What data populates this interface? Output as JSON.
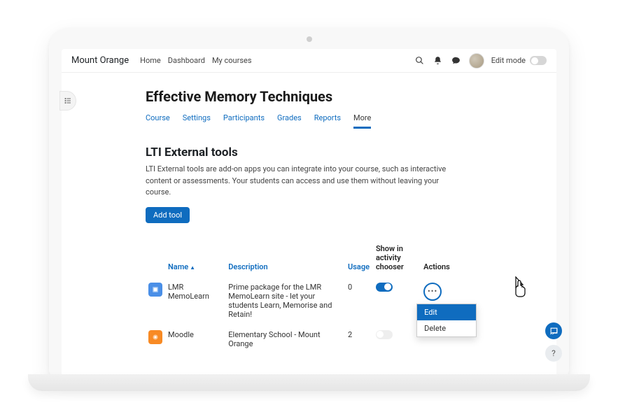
{
  "brand": "Mount Orange",
  "nav": {
    "home": "Home",
    "dashboard": "Dashboard",
    "mycourses": "My courses"
  },
  "editmode_label": "Edit mode",
  "page_title": "Effective Memory Techniques",
  "tabs": {
    "course": "Course",
    "settings": "Settings",
    "participants": "Participants",
    "grades": "Grades",
    "reports": "Reports",
    "more": "More"
  },
  "section": {
    "title": "LTI External tools",
    "desc": "LTI External tools are add-on apps you can integrate into your course, such as interactive content or assessments. Your students can access and use them without leaving your course.",
    "add_button": "Add tool"
  },
  "table": {
    "headers": {
      "name": "Name",
      "description": "Description",
      "usage": "Usage",
      "chooser": "Show in activity chooser",
      "actions": "Actions"
    },
    "rows": [
      {
        "icon_letter": "",
        "icon_class": "blue",
        "name": "LMR MemoLearn",
        "description": "Prime package for the LMR MemoLearn site - let your students Learn, Memorise and Retain!",
        "usage": "0",
        "chooser_on": true
      },
      {
        "icon_letter": "",
        "icon_class": "orange",
        "name": "Moodle",
        "description": "Elementary School - Mount Orange",
        "usage": "2",
        "chooser_on": false
      }
    ]
  },
  "dropdown": {
    "edit": "Edit",
    "delete": "Delete"
  }
}
